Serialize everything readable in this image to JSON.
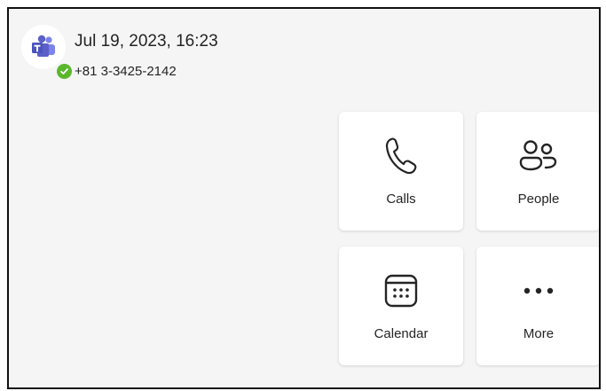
{
  "header": {
    "datetime": "Jul 19, 2023, 16:23",
    "phone": "+81 3-3425-2142",
    "avatar_icon": "teams-logo-icon",
    "presence_icon": "available-check-icon",
    "presence_color": "#5ab72c"
  },
  "tiles": [
    {
      "label": "Calls",
      "icon": "phone-icon"
    },
    {
      "label": "People",
      "icon": "people-icon"
    },
    {
      "label": "Calendar",
      "icon": "calendar-icon"
    },
    {
      "label": "More",
      "icon": "more-icon"
    }
  ],
  "colors": {
    "background": "#f5f5f5",
    "tile": "#ffffff",
    "text": "#242424",
    "teams_brand": "#5b5fc7"
  }
}
